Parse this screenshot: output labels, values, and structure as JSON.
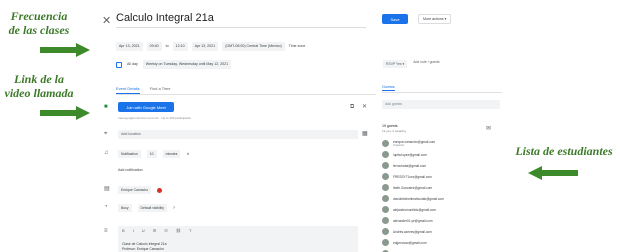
{
  "annotations": {
    "frequency": [
      "Frecuencia",
      "de las clases"
    ],
    "video_link": [
      "Link de la",
      "video llamada"
    ],
    "students": "Lista de estudiantes"
  },
  "event": {
    "title": "Calculo Integral 21a",
    "start_date": "Apr 13, 2021",
    "start_time": "09:40",
    "to": "to",
    "end_time": "12:10",
    "end_date": "Apr 13, 2021",
    "timezone": "(GMT-05:00) Central Time (Mexico)",
    "time_zone_link": "Time zone",
    "all_day": "All day",
    "recurrence": "Weekly on Tuesday, Wednesday until May 12, 2021"
  },
  "tabs": [
    "Event Details",
    "Find a Time"
  ],
  "meet": {
    "button": "Join with Google Meet",
    "subtext": "meet.google.com/xxx-xxxx-xxx · Up to 100 participants"
  },
  "location": "Add location",
  "notification": {
    "type": "Notification",
    "value": "10",
    "unit": "minutes",
    "add": "Add notification"
  },
  "calendar_owner": "Enrique Camacho",
  "availability": {
    "busy": "Busy",
    "visibility": "Default visibility"
  },
  "description": {
    "toolbar": [
      "B",
      "I",
      "U",
      "☰",
      "☷",
      "⛓",
      "T"
    ],
    "lines": [
      "Clase de Calculo Integral 21a",
      "Profesor: Enrique Camacho"
    ]
  },
  "actions": {
    "save": "Save",
    "more": "More actions ▾"
  },
  "rsvp": {
    "label": "RSVP Yes ▾",
    "add_note": "Add note / guests"
  },
  "guests": {
    "tab": "Guests",
    "add_placeholder": "Add guests",
    "count": "19 guests",
    "count_sub": "19 yes, 0 awaiting",
    "list": [
      {
        "email": "enrique.camacho@gmail.com",
        "org": "Organizer"
      },
      {
        "email": "lupita.lopez@gmail.com",
        "org": ""
      },
      {
        "email": "ferrochaba@gmail.com",
        "org": ""
      },
      {
        "email": "FRESSY71xxx@gmail.com",
        "org": ""
      },
      {
        "email": "Ibeth.Gonzalez@gmail.com",
        "org": ""
      },
      {
        "email": "davidmitchellmathcolab@gmail.com",
        "org": ""
      },
      {
        "email": "alejandromuntildo@gmail.com",
        "org": ""
      },
      {
        "email": "alexander01.ye@gmail.com",
        "org": ""
      },
      {
        "email": "Andrés.aceves@gmail.com",
        "org": ""
      },
      {
        "email": "edgenovao@gmail.com",
        "org": ""
      },
      {
        "email": "Franklin Cruz Rodriguez",
        "org": ""
      }
    ]
  },
  "colors": {
    "accent": "#1a73e8",
    "annotation": "#3d7a2a",
    "arrow": "#3d8a2a",
    "event_color": "#d93025"
  }
}
